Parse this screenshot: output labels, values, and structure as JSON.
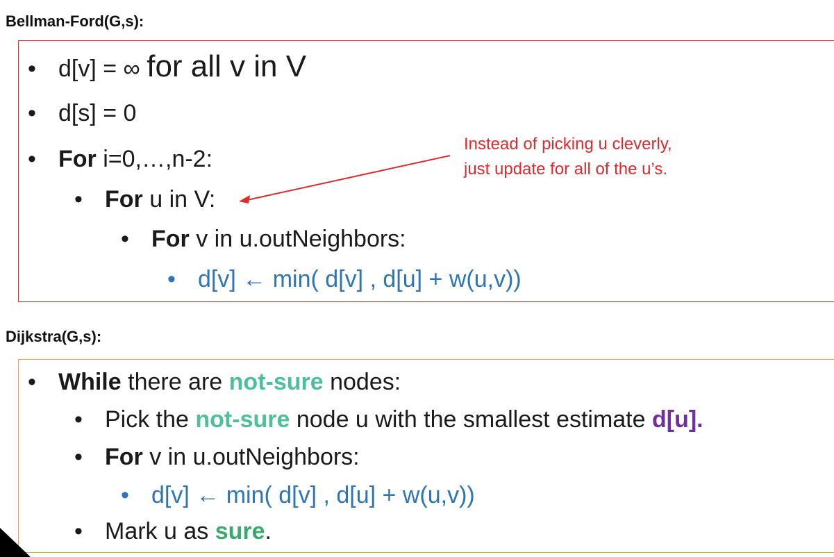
{
  "bellman_ford": {
    "heading": "Bellman-Ford(G,s):",
    "line1": {
      "bullet": "•",
      "pre": "d[v] = ∞ ",
      "post": "for all v in V"
    },
    "line2": {
      "bullet": "•",
      "text": "d[s] = 0"
    },
    "line3": {
      "bullet": "•",
      "keyword": "For",
      "text": " i=0,…,n-2:"
    },
    "line4": {
      "bullet": "•",
      "keyword": "For",
      "text": " u in V:"
    },
    "line5": {
      "bullet": "•",
      "keyword": "For",
      "text": " v in u.outNeighbors:"
    },
    "line6": {
      "bullet": "•",
      "text": "d[v] ← min( d[v] , d[u] + w(u,v))"
    },
    "annotation": {
      "line1": "Instead of picking u cleverly,",
      "line2": "just update for all of the u’s."
    }
  },
  "dijkstra": {
    "heading": "Dijkstra(G,s):",
    "line1": {
      "bullet": "•",
      "keyword": "While",
      "pre": " there are ",
      "highlight": "not-sure",
      "post": " nodes:"
    },
    "line2": {
      "bullet": "•",
      "pre": "Pick the ",
      "highlight": "not-sure",
      "mid": " node u with the smallest estimate ",
      "emph": "d[u]."
    },
    "line3": {
      "bullet": "•",
      "keyword": "For",
      "text": " v in u.outNeighbors:"
    },
    "line4": {
      "bullet": "•",
      "text": "d[v] ← min( d[v] , d[u] + w(u,v))"
    },
    "line5": {
      "bullet": "•",
      "pre": "Mark u as ",
      "highlight": "sure",
      "post": "."
    }
  },
  "colors": {
    "bellman_border": "#e0292b",
    "dijkstra_border": "#e8a24a",
    "annotation": "#e0292b",
    "update_rule": "#2e75b6",
    "not_sure": "#4dbf9a",
    "sure": "#3aaa6e",
    "estimate": "#7030a0"
  }
}
